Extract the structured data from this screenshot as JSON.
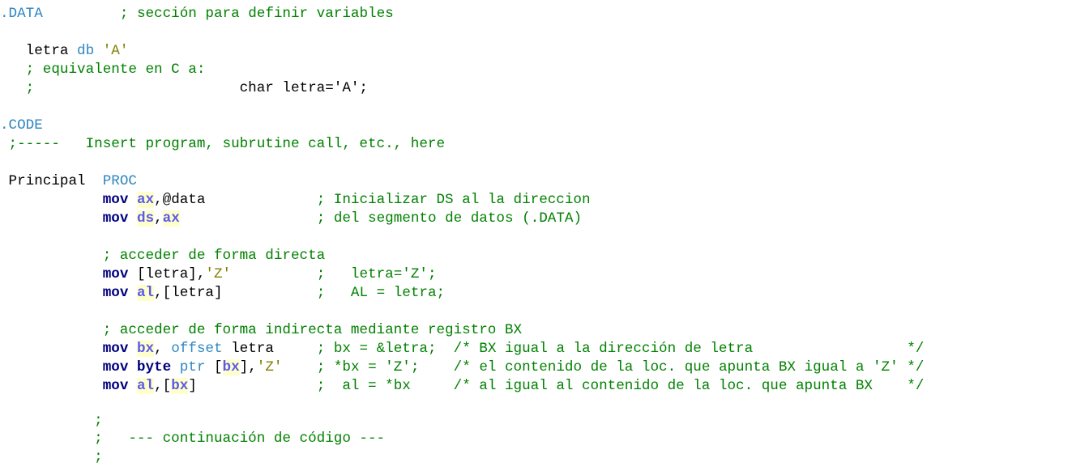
{
  "editor": {
    "lines": [
      {
        "id": "data-directive",
        "parts": [
          {
            "t": "dir",
            "v": ".DATA"
          },
          {
            "t": "txt",
            "v": "         "
          },
          {
            "t": "cmt",
            "v": "; sección para definir variables"
          }
        ]
      },
      {
        "id": "letra-decl",
        "parts": [
          {
            "t": "txt",
            "v": "   letra "
          },
          {
            "t": "key",
            "v": "db"
          },
          {
            "t": "txt",
            "v": " "
          },
          {
            "t": "str",
            "v": "'A'"
          }
        ]
      },
      {
        "id": "equiv-comment",
        "parts": [
          {
            "t": "cmt",
            "v": "   ; equivalente en C a:"
          }
        ]
      },
      {
        "id": "c-decl-comment",
        "parts": [
          {
            "t": "cmt",
            "v": "   ;"
          },
          {
            "t": "txt",
            "v": "                        char letra='A';"
          }
        ]
      },
      {
        "id": "code-directive",
        "parts": [
          {
            "t": "dir",
            "v": ".CODE"
          }
        ]
      },
      {
        "id": "insert-comment",
        "parts": [
          {
            "t": "cmt",
            "v": " ;-----   Insert program, subrutine call, etc., here"
          }
        ]
      },
      {
        "id": "proc-line",
        "parts": [
          {
            "t": "txt",
            "v": " Principal  "
          },
          {
            "t": "dir",
            "v": "PROC"
          }
        ]
      },
      {
        "id": "mov-ax-data",
        "parts": [
          {
            "t": "txt",
            "v": "            "
          },
          {
            "t": "kw",
            "v": "mov"
          },
          {
            "t": "txt",
            "v": " "
          },
          {
            "t": "reg",
            "v": "ax"
          },
          {
            "t": "txt",
            "v": ",@data             "
          },
          {
            "t": "cmt",
            "v": "; Inicializar DS al la direccion"
          }
        ]
      },
      {
        "id": "mov-ds-ax",
        "parts": [
          {
            "t": "txt",
            "v": "            "
          },
          {
            "t": "kw",
            "v": "mov"
          },
          {
            "t": "txt",
            "v": " "
          },
          {
            "t": "reg",
            "v": "ds"
          },
          {
            "t": "txt",
            "v": ","
          },
          {
            "t": "reg",
            "v": "ax"
          },
          {
            "t": "txt",
            "v": "                "
          },
          {
            "t": "cmt",
            "v": "; del segmento de datos (.DATA)"
          }
        ]
      },
      {
        "id": "direct-comment",
        "parts": [
          {
            "t": "cmt",
            "v": "            ; acceder de forma directa"
          }
        ]
      },
      {
        "id": "mov-letra-z",
        "parts": [
          {
            "t": "txt",
            "v": "            "
          },
          {
            "t": "kw",
            "v": "mov"
          },
          {
            "t": "txt",
            "v": " [letra],"
          },
          {
            "t": "str",
            "v": "'Z'"
          },
          {
            "t": "txt",
            "v": "          "
          },
          {
            "t": "cmt",
            "v": ";   letra='Z';"
          }
        ]
      },
      {
        "id": "mov-al-letra",
        "parts": [
          {
            "t": "txt",
            "v": "            "
          },
          {
            "t": "kw",
            "v": "mov"
          },
          {
            "t": "txt",
            "v": " "
          },
          {
            "t": "reg",
            "v": "al"
          },
          {
            "t": "txt",
            "v": ",[letra]           "
          },
          {
            "t": "cmt",
            "v": ";   AL = letra;"
          }
        ]
      },
      {
        "id": "indirect-comment",
        "parts": [
          {
            "t": "cmt",
            "v": "            ; acceder de forma indirecta mediante registro BX"
          }
        ]
      },
      {
        "id": "mov-bx-offset",
        "parts": [
          {
            "t": "txt",
            "v": "            "
          },
          {
            "t": "kw",
            "v": "mov"
          },
          {
            "t": "txt",
            "v": " "
          },
          {
            "t": "reg",
            "v": "bx"
          },
          {
            "t": "txt",
            "v": ", "
          },
          {
            "t": "key",
            "v": "offset"
          },
          {
            "t": "txt",
            "v": " letra     "
          },
          {
            "t": "cmt",
            "v": "; bx = &letra;  /* BX igual a la dirección de letra                  */"
          }
        ]
      },
      {
        "id": "mov-byte-ptr",
        "parts": [
          {
            "t": "txt",
            "v": "            "
          },
          {
            "t": "kw",
            "v": "mov byte"
          },
          {
            "t": "txt",
            "v": " "
          },
          {
            "t": "key",
            "v": "ptr"
          },
          {
            "t": "txt",
            "v": " ["
          },
          {
            "t": "reg",
            "v": "bx"
          },
          {
            "t": "txt",
            "v": "],"
          },
          {
            "t": "str",
            "v": "'Z'"
          },
          {
            "t": "txt",
            "v": "    "
          },
          {
            "t": "cmt",
            "v": "; *bx = 'Z';    /* el contenido de la loc. que apunta BX igual a 'Z' */"
          }
        ]
      },
      {
        "id": "mov-al-bx",
        "parts": [
          {
            "t": "txt",
            "v": "            "
          },
          {
            "t": "kw",
            "v": "mov"
          },
          {
            "t": "txt",
            "v": " "
          },
          {
            "t": "reg",
            "v": "al"
          },
          {
            "t": "txt",
            "v": ",["
          },
          {
            "t": "reg",
            "v": "bx"
          },
          {
            "t": "txt",
            "v": "]              "
          },
          {
            "t": "cmt",
            "v": ";  al = *bx     /* al igual al contenido de la loc. que apunta BX    */"
          }
        ]
      },
      {
        "id": "semicolon-1",
        "parts": [
          {
            "t": "cmt",
            "v": "           ;"
          }
        ]
      },
      {
        "id": "continuation-comment",
        "parts": [
          {
            "t": "cmt",
            "v": "           ;   --- continuación de código ---"
          }
        ]
      },
      {
        "id": "semicolon-2",
        "parts": [
          {
            "t": "cmt",
            "v": "           ;"
          }
        ]
      }
    ]
  }
}
